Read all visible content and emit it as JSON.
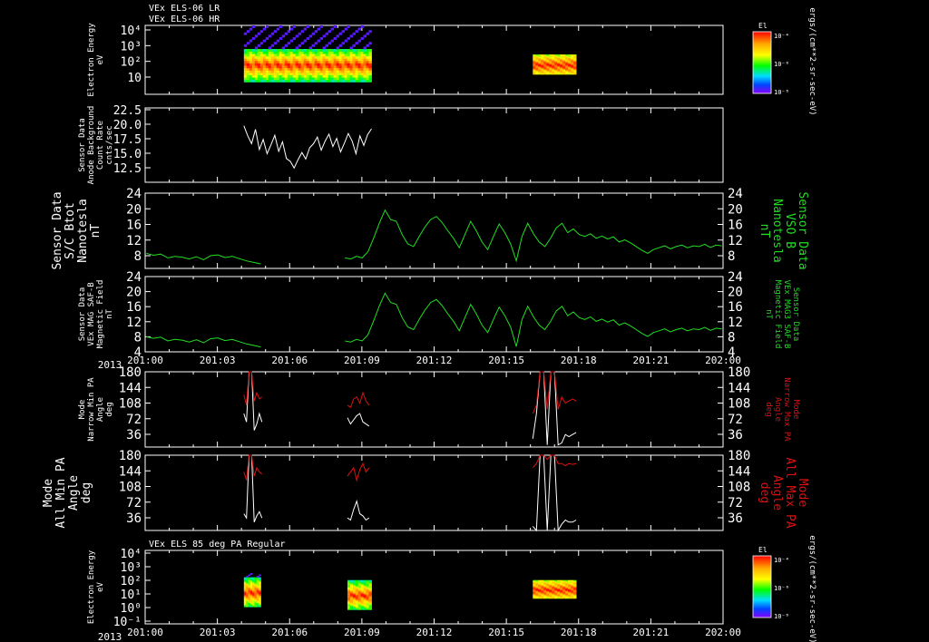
{
  "colors": {
    "background": "#000000",
    "frame": "#ffffff",
    "white_trace": "#ffffff",
    "green_trace": "#22dd22",
    "red_trace": "#dd1111"
  },
  "time_axis": {
    "year_label": "2013",
    "tick_labels": [
      "201:00",
      "201:03",
      "201:06",
      "201:09",
      "201:12",
      "201:15",
      "201:18",
      "201:21",
      "202:00"
    ],
    "range_hours": [
      0,
      24
    ]
  },
  "colorbar": {
    "title": "El",
    "tick_labels": [
      "10⁻⁴",
      "10⁻⁶",
      "10⁻⁸"
    ],
    "unit": "ergs/(cm**2-sr-sec-eV)"
  },
  "chart_data": [
    {
      "id": "els06",
      "type": "heatmap",
      "titles": [
        "VEx ELS-06 LR",
        "VEx ELS-06 HR"
      ],
      "ylabel": [
        "Electron Energy",
        "eV"
      ],
      "y_ticks": [
        "10⁴",
        "10³",
        "10²",
        "10"
      ],
      "blocks": [
        {
          "x_start": 4.1,
          "x_end": 9.4,
          "y_low_exp": 0.5,
          "y_high_exp": 4.2,
          "core_exp": 1.6
        },
        {
          "x_start": 16.1,
          "x_end": 17.9,
          "y_low_exp": 1.0,
          "y_high_exp": 2.3,
          "core_exp": 1.6
        }
      ],
      "y_range_exp": [
        -0.3,
        4.2
      ]
    },
    {
      "id": "background",
      "type": "line",
      "ylabel": [
        "Sensor Data",
        "Anode Background",
        "Count Rate",
        "cnts/sec"
      ],
      "y_ticks": [
        "22.5",
        "20.0",
        "17.5",
        "15.0",
        "12.5"
      ],
      "ylim": [
        10.0,
        22.5
      ],
      "series": [
        {
          "x_start": 4.1,
          "x_end": 9.4,
          "values": [
            19.5,
            17.8,
            16.5,
            18.9,
            15.5,
            17.2,
            14.8,
            16.3,
            17.9,
            15.2,
            16.8,
            14.0,
            13.5,
            12.4,
            13.8,
            15.0,
            13.9,
            15.8,
            16.5,
            17.6,
            15.4,
            16.9,
            18.1,
            16.0,
            17.4,
            15.1,
            16.6,
            18.2,
            16.9,
            14.8,
            17.8,
            16.2,
            18.0,
            19.0
          ]
        }
      ]
    },
    {
      "id": "vso_b",
      "type": "line",
      "ylabel": [
        "Sensor Data",
        "S/C Btot",
        "Nanotesla",
        "nT"
      ],
      "ylabel_right": [
        "Sensor Data",
        "VSO B",
        "Nanotesla",
        "nT"
      ],
      "y_ticks": [
        "24",
        "20",
        "16",
        "12",
        "8"
      ],
      "ylim": [
        4,
        24
      ],
      "series": [
        {
          "x_start": 0.05,
          "x_end": 4.8,
          "values": [
            8,
            7.5,
            7.8,
            6.8,
            7.2,
            7.0,
            6.5,
            7.1,
            6.3,
            7.4,
            7.6,
            6.9,
            7.2,
            6.6,
            6.0,
            5.6,
            5.2
          ]
        },
        {
          "x_start": 8.3,
          "x_end": 23.95,
          "values": [
            6.8,
            6.5,
            7.2,
            6.8,
            8.4,
            12,
            16,
            19.5,
            17,
            16.5,
            13,
            10.5,
            9.8,
            12.5,
            15,
            17,
            17.8,
            16.2,
            14,
            12,
            9.5,
            13,
            16.5,
            14,
            11,
            9,
            12.5,
            15.8,
            13.5,
            10.5,
            6.0,
            12.5,
            16.0,
            13.2,
            11,
            9.8,
            12,
            14.8,
            16,
            13.5,
            14.5,
            13.0,
            12.5,
            13.2,
            12.0,
            12.6,
            11.8,
            12.4,
            11.0,
            11.6,
            10.8,
            9.8,
            8.8,
            8.0,
            9.0,
            9.5,
            10.0,
            9.2,
            9.8,
            10.2,
            9.5,
            10.0,
            9.8,
            10.4,
            9.6,
            10.2,
            10.0
          ]
        }
      ]
    },
    {
      "id": "mag3_saf",
      "type": "line",
      "ylabel": [
        "Sensor Data",
        "VEx MAG SAF-B",
        "Magnetic Field",
        "nT"
      ],
      "ylabel_right": [
        "Sensor Data",
        "VEx MAG3 SAF-B",
        "Magnetic Field",
        "nT"
      ],
      "y_ticks": [
        "24",
        "20",
        "16",
        "12",
        "8",
        "4"
      ],
      "ylim": [
        4,
        24
      ],
      "series": [
        {
          "x_start": 0.05,
          "x_end": 4.8,
          "values": [
            8.0,
            7.6,
            7.9,
            6.9,
            7.3,
            7.1,
            6.6,
            7.2,
            6.4,
            7.5,
            7.7,
            7.0,
            7.3,
            6.7,
            6.1,
            5.7,
            5.3
          ]
        },
        {
          "x_start": 8.3,
          "x_end": 23.95,
          "values": [
            6.9,
            6.6,
            7.3,
            6.9,
            8.5,
            12.2,
            16.2,
            19.6,
            17.1,
            16.6,
            13.1,
            10.6,
            9.9,
            12.6,
            15.1,
            17.1,
            17.9,
            16.3,
            14.1,
            12.1,
            9.6,
            13.1,
            16.6,
            14.1,
            11.1,
            9.1,
            12.6,
            15.9,
            13.6,
            10.6,
            5.4,
            12.6,
            16.1,
            13.3,
            11.1,
            9.9,
            12.1,
            14.9,
            16.1,
            13.6,
            14.6,
            13.1,
            12.6,
            13.3,
            12.1,
            12.7,
            11.9,
            12.5,
            11.1,
            11.7,
            10.9,
            9.9,
            8.9,
            8.1,
            9.1,
            9.6,
            10.1,
            9.3,
            9.9,
            10.3,
            9.6,
            10.1,
            9.9,
            10.5,
            9.7,
            10.3,
            10.1
          ]
        }
      ]
    },
    {
      "id": "narrow_pa",
      "type": "line",
      "ylabel": [
        "Mode",
        "Narrow Min PA",
        "Angle",
        "deg"
      ],
      "ylabel_right": [
        "Mode",
        "Narrow Max PA",
        "Angle",
        "deg"
      ],
      "y_ticks": [
        "180",
        "144",
        "108",
        "72",
        "36"
      ],
      "ylim": [
        0,
        180
      ],
      "series": [
        {
          "name": "min",
          "x_start": 4.1,
          "x_end": 4.85,
          "values": [
            80,
            60,
            180,
            180,
            40,
            55,
            80,
            60
          ]
        },
        {
          "name": "max",
          "x_start": 4.1,
          "x_end": 4.85,
          "values": [
            125,
            100,
            180,
            180,
            110,
            130,
            115,
            120
          ]
        },
        {
          "name": "min",
          "x_start": 8.4,
          "x_end": 9.3,
          "values": [
            70,
            55,
            65,
            75,
            80,
            60,
            55,
            50
          ]
        },
        {
          "name": "max",
          "x_start": 8.4,
          "x_end": 9.3,
          "values": [
            100,
            95,
            115,
            120,
            105,
            130,
            110,
            100
          ]
        },
        {
          "name": "min",
          "x_start": 16.1,
          "x_end": 17.9,
          "values": [
            20,
            80,
            180,
            180,
            5,
            180,
            180,
            5,
            10,
            30,
            25,
            30,
            35
          ]
        },
        {
          "name": "max",
          "x_start": 16.1,
          "x_end": 17.9,
          "values": [
            80,
            100,
            180,
            180,
            90,
            180,
            180,
            90,
            120,
            105,
            110,
            115,
            110
          ]
        }
      ]
    },
    {
      "id": "all_pa",
      "type": "line",
      "ylabel": [
        "Mode",
        "All Min PA",
        "Angle",
        "deg"
      ],
      "ylabel_right": [
        "Mode",
        "All Max PA",
        "Angle",
        "deg"
      ],
      "y_ticks": [
        "180",
        "144",
        "108",
        "72",
        "36"
      ],
      "ylim": [
        0,
        180
      ],
      "series": [
        {
          "name": "min",
          "x_start": 4.1,
          "x_end": 4.85,
          "values": [
            40,
            30,
            180,
            180,
            20,
            35,
            45,
            30
          ]
        },
        {
          "name": "max",
          "x_start": 4.1,
          "x_end": 4.85,
          "values": [
            140,
            120,
            180,
            180,
            130,
            150,
            140,
            135
          ]
        },
        {
          "name": "min",
          "x_start": 8.4,
          "x_end": 9.3,
          "values": [
            30,
            25,
            50,
            70,
            40,
            35,
            25,
            30
          ]
        },
        {
          "name": "max",
          "x_start": 8.4,
          "x_end": 9.3,
          "values": [
            130,
            140,
            150,
            120,
            145,
            160,
            140,
            150
          ]
        },
        {
          "name": "min",
          "x_start": 16.1,
          "x_end": 17.9,
          "values": [
            10,
            0,
            180,
            180,
            0,
            180,
            180,
            0,
            15,
            25,
            20,
            20,
            25
          ]
        },
        {
          "name": "max",
          "x_start": 16.1,
          "x_end": 17.9,
          "values": [
            150,
            160,
            180,
            180,
            170,
            180,
            180,
            160,
            160,
            155,
            160,
            158,
            160
          ]
        }
      ]
    },
    {
      "id": "els85",
      "type": "heatmap",
      "titles": [
        "VEx ELS 85 deg PA Regular"
      ],
      "ylabel": [
        "Electron Energy",
        "eV"
      ],
      "y_ticks": [
        "10⁴",
        "10³",
        "10²",
        "10¹",
        "10⁰",
        "10⁻¹"
      ],
      "y_range_exp": [
        -1.0,
        4.2
      ],
      "blocks": [
        {
          "x_start": 4.1,
          "x_end": 4.8,
          "y_low_exp": 0.2,
          "y_high_exp": 2.6,
          "core_exp": 1.2
        },
        {
          "x_start": 8.4,
          "x_end": 9.4,
          "y_low_exp": 0.0,
          "y_high_exp": 2.1,
          "core_exp": 1.0
        },
        {
          "x_start": 16.1,
          "x_end": 17.9,
          "y_low_exp": 0.8,
          "y_high_exp": 2.1,
          "core_exp": 1.4
        }
      ]
    }
  ]
}
